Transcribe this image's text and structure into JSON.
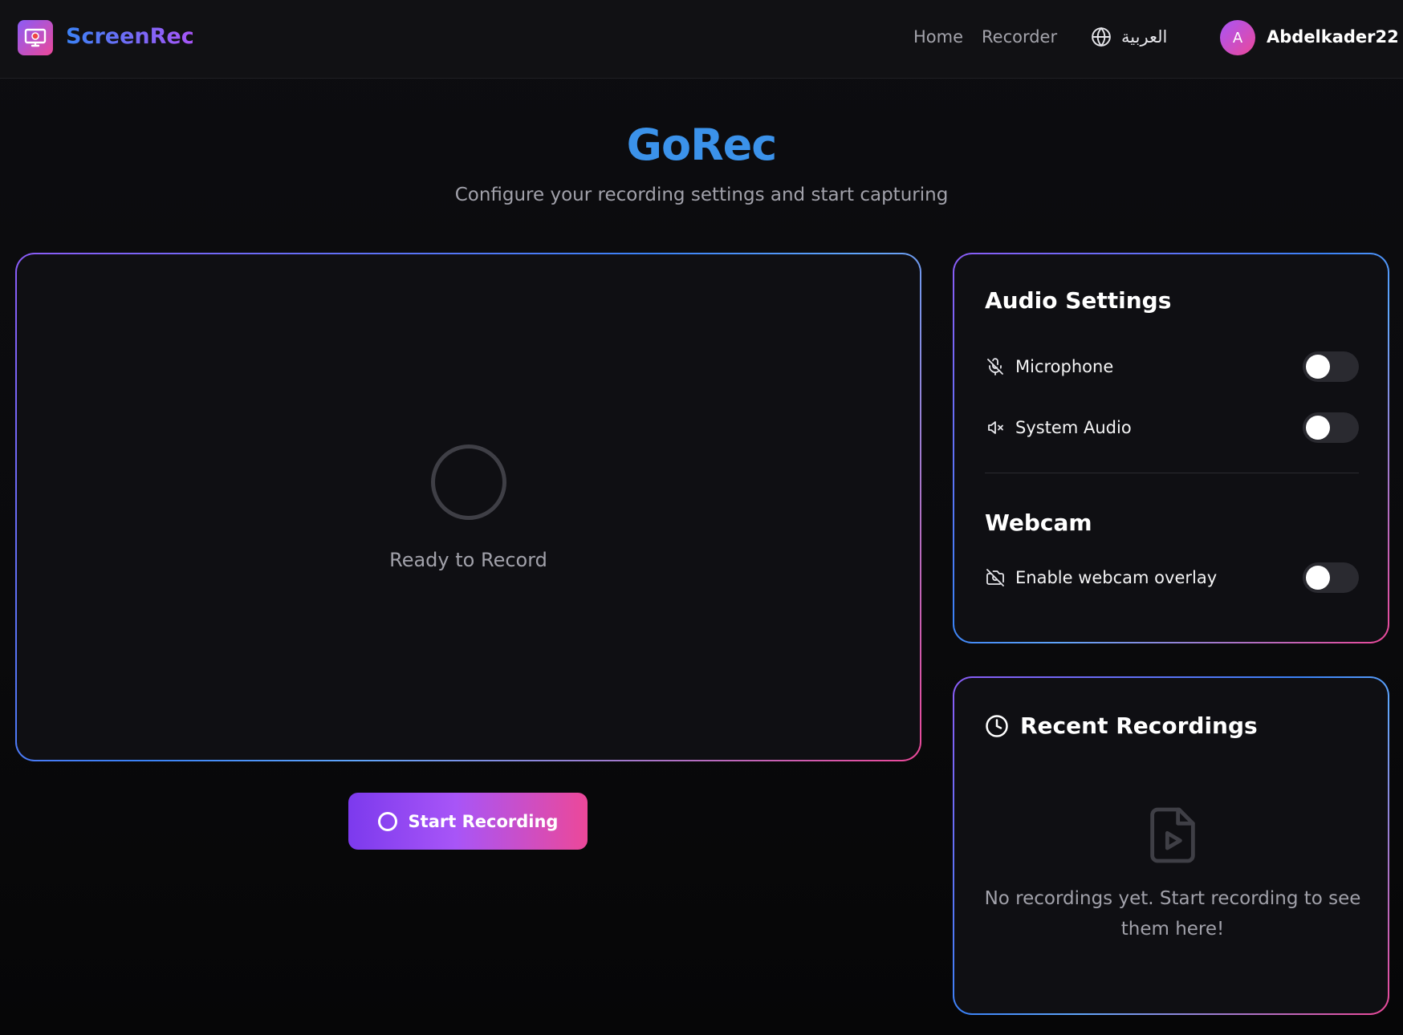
{
  "header": {
    "brand": "ScreenRec",
    "nav": [
      "Home",
      "Recorder"
    ],
    "language_label": "العربية",
    "avatar_initial": "A",
    "username": "Abdelkader22"
  },
  "hero": {
    "title": "GoRec",
    "subtitle": "Configure your recording settings and start capturing"
  },
  "preview": {
    "status": "Ready to Record",
    "start_button": "Start Recording"
  },
  "settings": {
    "audio_title": "Audio Settings",
    "microphone_label": "Microphone",
    "microphone_on": false,
    "system_audio_label": "System Audio",
    "system_audio_on": false,
    "webcam_title": "Webcam",
    "webcam_label": "Enable webcam overlay",
    "webcam_on": false
  },
  "recent": {
    "title": "Recent Recordings",
    "empty_message": "No recordings yet. Start recording to see them here!"
  },
  "colors": {
    "accent_blue": "#3b92ea",
    "accent_purple": "#a855f7",
    "accent_pink": "#ec4899",
    "background": "#0a0a0c"
  }
}
